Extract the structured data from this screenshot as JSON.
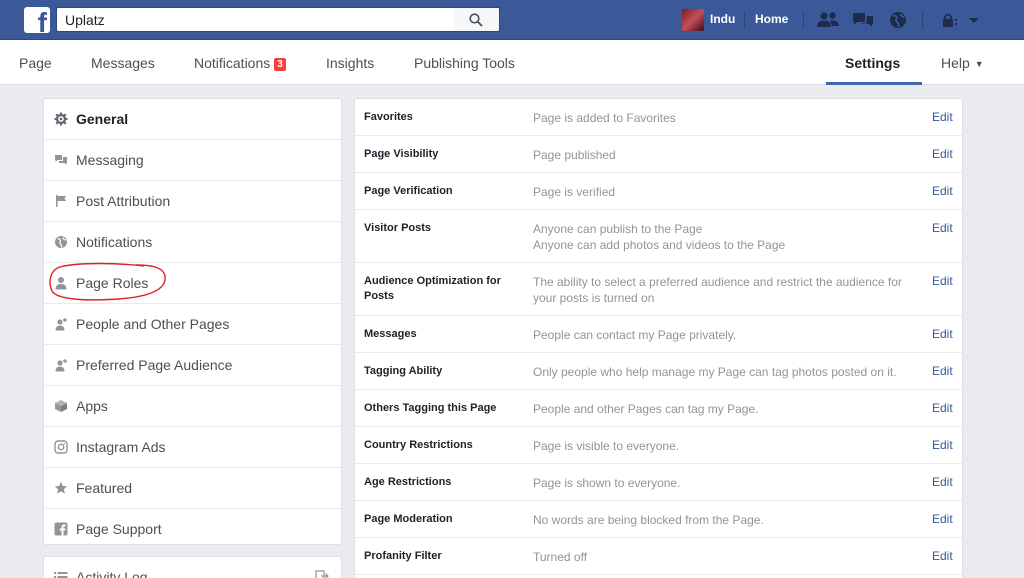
{
  "topbar": {
    "search_value": "Uplatz",
    "user_name": "Indu",
    "home_label": "Home"
  },
  "pagenav": {
    "page": "Page",
    "messages": "Messages",
    "notifications": "Notifications",
    "notifications_badge": "3",
    "insights": "Insights",
    "publishing_tools": "Publishing Tools",
    "settings": "Settings",
    "help": "Help"
  },
  "sidebar": {
    "items": [
      {
        "label": "General",
        "icon": "gear-icon"
      },
      {
        "label": "Messaging",
        "icon": "chat-icon"
      },
      {
        "label": "Post Attribution",
        "icon": "flag-icon"
      },
      {
        "label": "Notifications",
        "icon": "globe-icon"
      },
      {
        "label": "Page Roles",
        "icon": "person-icon"
      },
      {
        "label": "People and Other Pages",
        "icon": "person-plus-icon"
      },
      {
        "label": "Preferred Page Audience",
        "icon": "person-plus-icon"
      },
      {
        "label": "Apps",
        "icon": "cube-icon"
      },
      {
        "label": "Instagram Ads",
        "icon": "instagram-icon"
      },
      {
        "label": "Featured",
        "icon": "star-icon"
      },
      {
        "label": "Page Support",
        "icon": "facebook-icon"
      }
    ],
    "activity_log": "Activity Log"
  },
  "settings": {
    "rows": [
      {
        "key": "Favorites",
        "value": "Page is added to Favorites",
        "edit": "Edit"
      },
      {
        "key": "Page Visibility",
        "value": "Page published",
        "edit": "Edit"
      },
      {
        "key": "Page Verification",
        "value": "Page is verified",
        "edit": "Edit"
      },
      {
        "key": "Visitor Posts",
        "value": "Anyone can publish to the Page",
        "value2": "Anyone can add photos and videos to the Page",
        "edit": "Edit"
      },
      {
        "key": "Audience Optimization for Posts",
        "value": "The ability to select a preferred audience and restrict the audience for your posts is turned on",
        "edit": "Edit"
      },
      {
        "key": "Messages",
        "value": "People can contact my Page privately.",
        "edit": "Edit"
      },
      {
        "key": "Tagging Ability",
        "value": "Only people who help manage my Page can tag photos posted on it.",
        "edit": "Edit"
      },
      {
        "key": "Others Tagging this Page",
        "value": "People and other Pages can tag my Page.",
        "edit": "Edit"
      },
      {
        "key": "Country Restrictions",
        "value": "Page is visible to everyone.",
        "edit": "Edit"
      },
      {
        "key": "Age Restrictions",
        "value": "Page is shown to everyone.",
        "edit": "Edit"
      },
      {
        "key": "Page Moderation",
        "value": "No words are being blocked from the Page.",
        "edit": "Edit"
      },
      {
        "key": "Profanity Filter",
        "value": "Turned off",
        "edit": "Edit"
      }
    ]
  },
  "colors": {
    "brand_blue": "#3b5998",
    "link_blue": "#365899",
    "badge_red": "#fa3e3e",
    "annotation_red": "#e0202a"
  }
}
